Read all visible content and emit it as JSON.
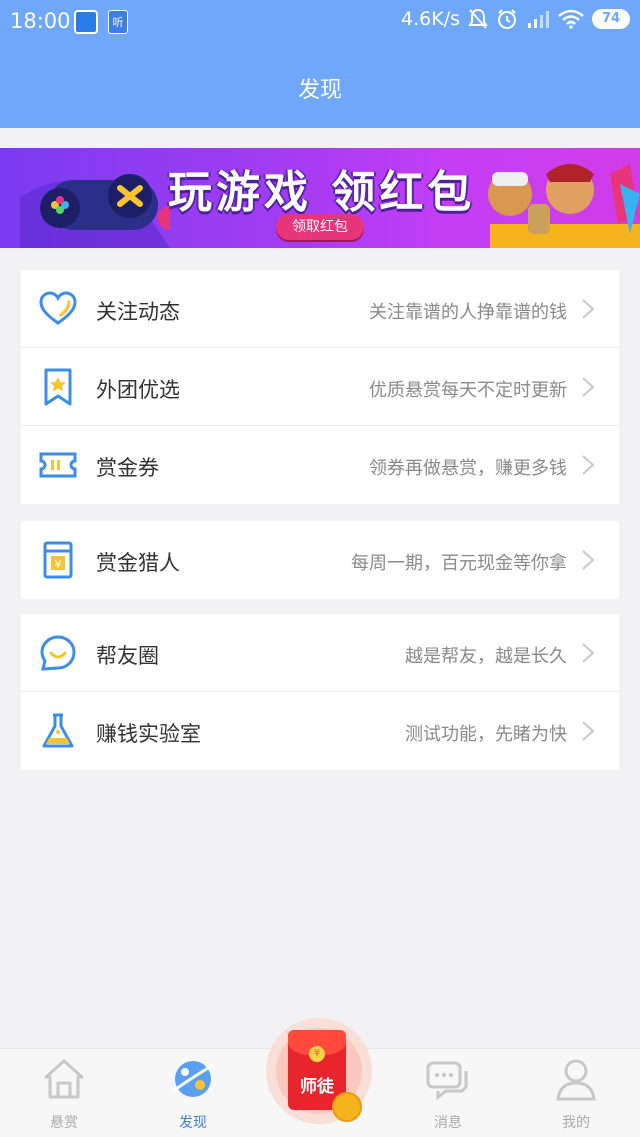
{
  "status": {
    "time": "18:00",
    "app_badge": "听",
    "net_speed": "4.6K/s",
    "battery": "74"
  },
  "header": {
    "title": "发现"
  },
  "banner": {
    "title": "玩游戏 领红包",
    "button": "领取红包"
  },
  "groups": [
    {
      "rows": [
        {
          "icon": "heart-icon",
          "label": "关注动态",
          "desc": "关注靠谱的人挣靠谱的钱"
        },
        {
          "icon": "bookmark-star-icon",
          "label": "外团优选",
          "desc": "优质悬赏每天不定时更新"
        },
        {
          "icon": "ticket-icon",
          "label": "赏金券",
          "desc": "领券再做悬赏，赚更多钱"
        }
      ]
    },
    {
      "rows": [
        {
          "icon": "money-envelope-icon",
          "label": "赏金猎人",
          "desc": "每周一期，百元现金等你拿"
        }
      ]
    },
    {
      "rows": [
        {
          "icon": "chat-smile-icon",
          "label": "帮友圈",
          "desc": "越是帮友，越是长久"
        },
        {
          "icon": "flask-icon",
          "label": "赚钱实验室",
          "desc": "测试功能，先睹为快"
        }
      ]
    }
  ],
  "bottom_nav": {
    "items": [
      {
        "label": "悬赏",
        "icon": "home-icon",
        "active": false
      },
      {
        "label": "发现",
        "icon": "planet-icon",
        "active": true
      },
      {
        "label": "消息",
        "icon": "chat-icon",
        "active": false
      },
      {
        "label": "我的",
        "icon": "user-icon",
        "active": false
      }
    ],
    "center_label": "师徒"
  },
  "colors": {
    "header_blue": "#6fa8fb",
    "icon_blue": "#3b8de8",
    "icon_yellow": "#f7c431",
    "active_blue": "#3b7ee6"
  }
}
